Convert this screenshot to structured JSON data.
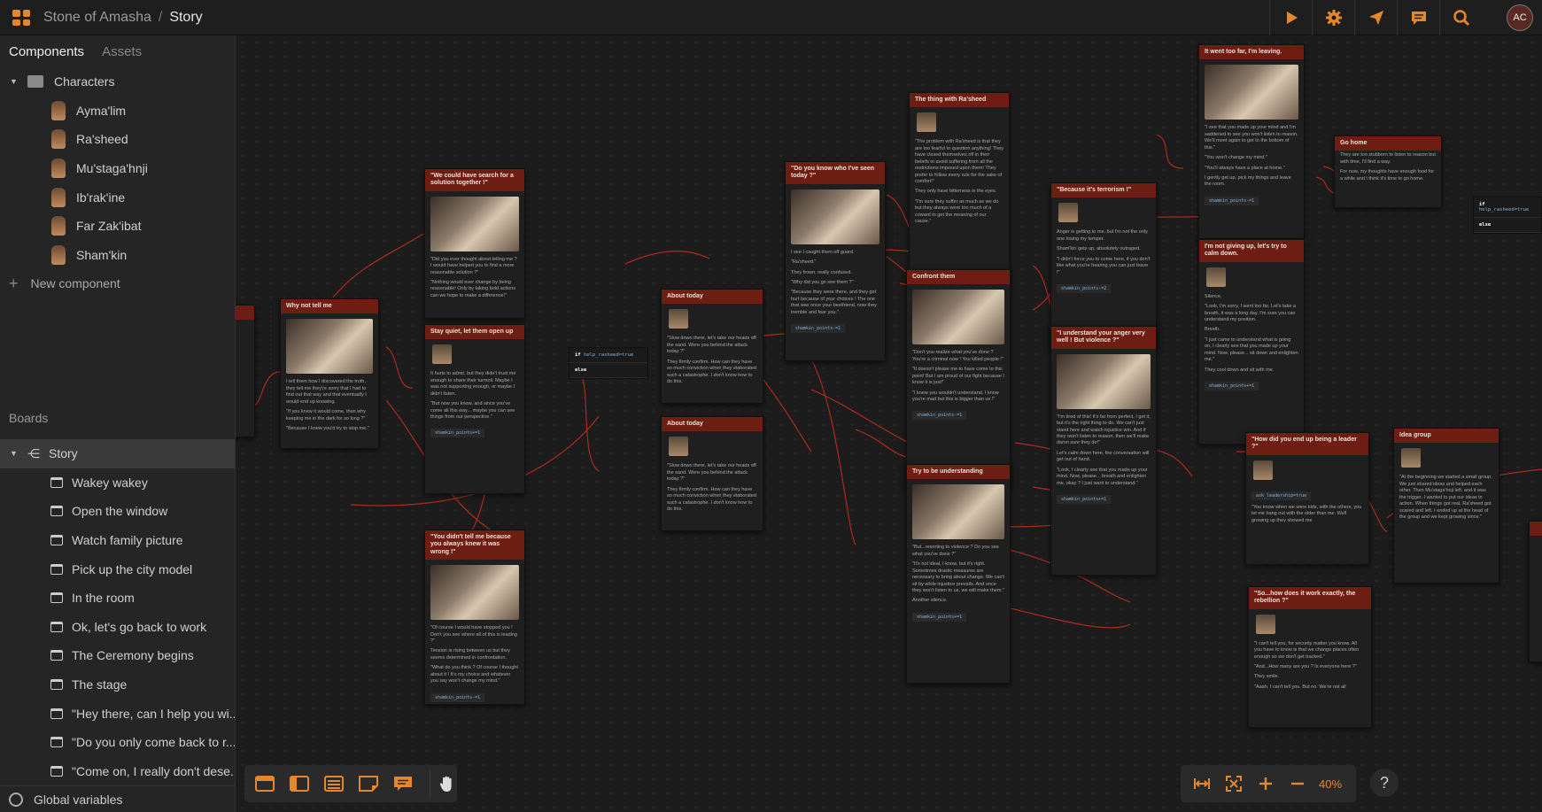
{
  "header": {
    "project": "Stone of Amasha",
    "separator": "/",
    "board": "Story",
    "user_initials": "AC"
  },
  "toolbar": {
    "icons": [
      "play-icon",
      "gear-icon",
      "send-icon",
      "comment-icon",
      "search-icon"
    ]
  },
  "sidebar": {
    "tabs": {
      "components": "Components",
      "assets": "Assets"
    },
    "characters_folder": "Characters",
    "characters": [
      "Ayma'lim",
      "Ra'sheed",
      "Mu'stagа'hnji",
      "Ib'rak'ine",
      "Far Zak'ibat",
      "Sham'kin"
    ],
    "new_component": "New component",
    "boards_header": "Boards",
    "story": "Story",
    "boards": [
      "Wakey wakey",
      "Open the window",
      "Watch family picture",
      "Pick up the city model",
      "In the room",
      "Ok, let's go back to work",
      "The Ceremony begins",
      "The stage",
      "\"Hey there, can I help you wi...",
      "\"Do you only come back to r...",
      "\"Come on, I really don't dese..."
    ],
    "global_variables": "Global variables"
  },
  "nodes": {
    "why": {
      "title": "Why not tell me",
      "text1": "I tell them how I discovered the truth, they tell me they're sorry that I had to find out that way and that eventually I would end up knowing.",
      "text2": "\"If you knew it would come, then why keeping me in the dark for so long ?\"",
      "text3": "\"Because I knew you'd try to stop me.\""
    },
    "could": {
      "title": "\"We could have search for a solution together !\"",
      "text1": "\"Did you ever thought about telling me ? I would have helped you to find a more reasonable solution ?\"",
      "text2": "\"Nothing would ever change by being reasonable! Only by taking bold actions can we hope to make a difference!\""
    },
    "quiet": {
      "title": "Stay quiet, let them open up",
      "text1": "It hurts to admit, but they didn't trust me enough to share their turmoil. Maybe I was not supporting enough, or maybe I didn't listen.",
      "text2": "\"But now you know, and since you've come all this way... maybe you can see things from our perspective.\"",
      "var": "shamkin_points+=1"
    },
    "didnt": {
      "title": "\"You didn't tell me because you always knew it was wrong !\"",
      "text1": "\"Of course I would have stopped you ! Don't you see where all of this is leading ?\"",
      "text2": "Tension is rising between us but they seems determined in confrontation.",
      "text3": "\"What do you think ? Of course I thought about it ! It's my choice and whatever you say won't change my mind.\"",
      "var": "shamkin_points-=1"
    },
    "cond1": {
      "if": "if",
      "expr": "help_rasheed=true",
      "else": "else"
    },
    "about1": {
      "title": "About today",
      "text1": "\"Slow down there, let's take our heads off the sand. Were you behind the attack today ?\"",
      "text2": "They firmly confirm. How can they have so much conviction when they elaborated such a catastrophe. I don't know how to do this."
    },
    "about2": {
      "title": "About today",
      "text1": "\"Slow down there, let's take our heads off the sand. Were you behind the attack today ?\"",
      "text2": "They firmly confirm. How can they have so much conviction when they elaborated such a catastrophe. I don't know how to do this."
    },
    "seen": {
      "title": "\"Do you know who I've seen today ?\"",
      "text1": "I see I caught them off guard.",
      "text2": "\"Ra'sheed.\"",
      "text3": "They frown, really confused.",
      "text4": "\"Why did you go see them ?\"",
      "text5": "\"Because they were there, and they got hurt because of your choices ! The one that was once your bestfriend, now they tremble and fear you.\"",
      "var": "shamkin_points-=1"
    },
    "thing": {
      "title": "The thing with Ra'sheed",
      "text1": "\"The problem with Ra'sheed is that they are too fearful to question anything! They have closed themselves off in their beliefs to avoid suffering from all the restrictions imposed upon them! They prefer to follow every rule for the sake of comfort!\"",
      "text2": "They only have bitterness in the eyes.",
      "text3": "\"I'm sure they suffer as much as we do but they always were too much of a coward to get the meaning of our cause.\""
    },
    "confront": {
      "title": "Confront them",
      "text1": "\"Don't you realize what you've done ? You're a criminal now ! You killed people !\"",
      "text2": "\"It doesn't please me to have come to this point! But I am proud of our fight because I know it is just!\"",
      "text3": "\"I knew you wouldn't understand. I know you're mad but this is bigger than us !\"",
      "var": "shamkin_points-=1"
    },
    "try": {
      "title": "Try to be understanding",
      "text1": "\"But...resorting to violence ? Do you see what you've done ?\"",
      "text2": "\"It's not ideal, I know, but it's right. Sometimes drastic measures are necessary to bring about change. We can't sit by while injustice prevails. And once they won't listen to us, we will make them.\"",
      "text3": "Another silence.",
      "var": "shamkin_points+=1"
    },
    "terror": {
      "title": "\"Because it's terrorism !\"",
      "text1": "Anger is getting to me, but I'm not the only one losing my temper.",
      "text2": "Sham'kin gets up, absolutely outraged.",
      "text3": "\"I didn't force you to come here, if you don't like what you're hearing you can just leave !\"",
      "var": "shamkin_points-=2"
    },
    "anger": {
      "title": "\"I understand your anger very well ! But violence ?\"",
      "text1": "\"I'm tired of this! It's far from perfect, I get it, but it's the right thing to do. We can't just stand here and watch injustice win. And if they won't listen to reason, then we'll make damn sure they do!\"",
      "text2": "Let's calm down here, the conversation will get out of hand.",
      "text3": "\"Look, I clearly see that you made up your mind. Now, please... breath and enlighten me, okay ? I just want to understand.\"",
      "var": "shamkin_points+=1"
    },
    "far": {
      "title": "It went too far, I'm leaving.",
      "text1": "\"I see that you made up your mind and I'm saddened to see you won't listen to reason. We'll meet again to get to the bottom of this.\"",
      "text2": "\"You won't change my mind.\"",
      "text3": "\"You'll always have a place at home.\"",
      "text4": "I gently get up, pick my things and leave the room.",
      "var": "shamkin_points-=1"
    },
    "home": {
      "title": "Go home",
      "text1": "They are too stubborn to listen to reason but with time, I'll find a way.",
      "text2": "For now, my thoughts have enough food for a while and I think it's time to go home."
    },
    "giving": {
      "title": "I'm not giving up, let's try to calm down.",
      "text1": "Silence.",
      "text2": "\"Look, I'm sorry, I went too far. Let's take a breath, it was a long day. I'm sure you can understand my position.",
      "text3": "Breath.",
      "text4": "\"I just came to understand what is going on, I clearly see that you made up your mind. Now, please... sit down and enlighten me.\"",
      "text5": "They cool down and sit with me.",
      "var": "shamkin_points+=1"
    },
    "leader": {
      "title": "\"How did you end up being a leader ?\"",
      "var": "ask_leadership=true",
      "text1": "\"You know when we were kids, with the others, you let me hang out with the older than me. Well growing up they showed me"
    },
    "idea": {
      "title": "Idea group",
      "text1": "\"At the beginning we started a small group. We just shared ideas and helped each other. Then Mu'stagа'hnji left, and it was the trigger. I wanted to put our ideas in action. When things got real, Ra'sheed got scared and left. I ended up at the head of the group and we kept growing since.\""
    },
    "rebel": {
      "title": "\"So...how does it work exactly, the rebellion ?\"",
      "text1": "\"I can't tell you, for security matter you know. All you have to know is that we change places often enough so we don't get tracked.\"",
      "text2": "\"And...How many are you ? Is everyone here ?\"",
      "text3": "They smile.",
      "text4": "\"Aaah. I can't tell you. But no. We're not all"
    },
    "cond2": {
      "if": "if",
      "expr": "help_rasheed=true",
      "else": "else"
    }
  },
  "board_tools": [
    "card-icon",
    "panel-icon",
    "list-icon",
    "note-icon",
    "comment-icon",
    "hand-icon"
  ],
  "zoom": {
    "level": "40%",
    "icons": [
      "fit-width-icon",
      "fullscreen-icon",
      "zoom-in-icon",
      "zoom-out-icon"
    ]
  },
  "help": "?"
}
